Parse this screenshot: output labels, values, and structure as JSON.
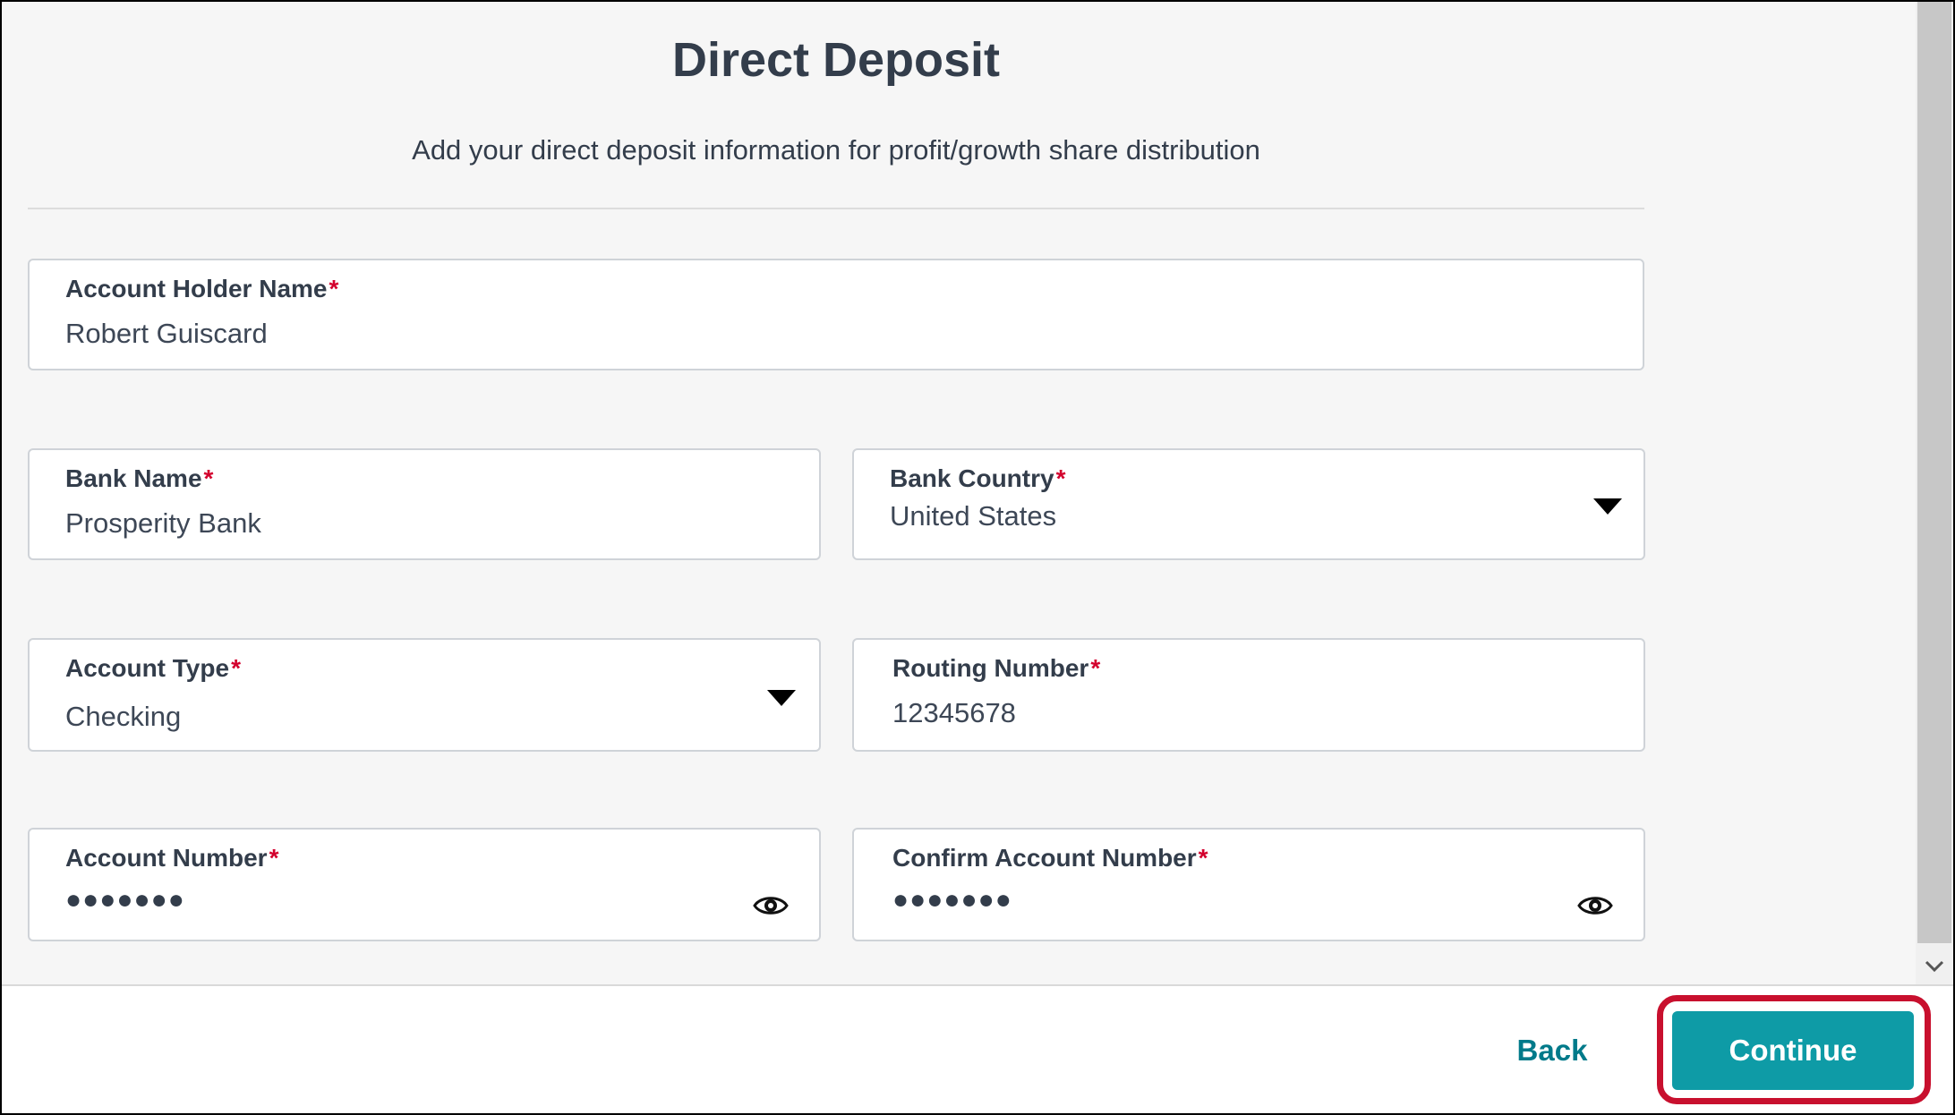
{
  "header": {
    "title": "Direct Deposit",
    "subtitle": "Add your direct deposit information for profit/growth share distribution"
  },
  "form": {
    "required_marker": "*",
    "account_holder": {
      "label": "Account Holder Name",
      "value": "Robert Guiscard"
    },
    "bank_name": {
      "label": "Bank Name",
      "value": "Prosperity Bank"
    },
    "bank_country": {
      "label": "Bank Country",
      "value": "United States"
    },
    "account_type": {
      "label": "Account Type",
      "value": "Checking"
    },
    "routing_number": {
      "label": "Routing Number",
      "value": "12345678"
    },
    "account_number": {
      "label": "Account Number",
      "value": "●●●●●●●"
    },
    "confirm_account_number": {
      "label": "Confirm Account Number",
      "value": "●●●●●●●"
    }
  },
  "footer": {
    "back_label": "Back",
    "continue_label": "Continue"
  },
  "colors": {
    "accent": "#0e9ba6",
    "link": "#007a8a",
    "required": "#d3002d",
    "highlight": "#c8102e"
  },
  "icons": {
    "dropdown": "caret-down-icon",
    "reveal": "eye-icon",
    "scroll": "chevron-down-icon"
  }
}
